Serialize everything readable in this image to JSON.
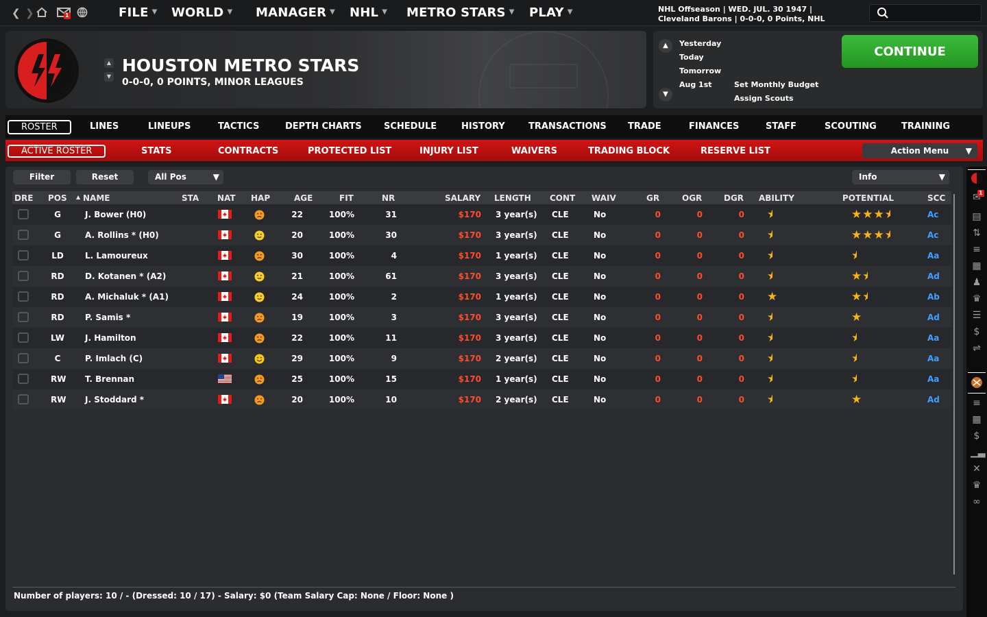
{
  "topbar": {
    "menus": [
      "FILE",
      "WORLD",
      "MANAGER",
      "NHL",
      "METRO STARS",
      "PLAY"
    ],
    "mail_badge": "1",
    "status_line1": "NHL Offseason |  WED. JUL. 30 1947 |",
    "status_line2": "Cleveland Barons |  0-0-0, 0 Points, NHL"
  },
  "team": {
    "name": "HOUSTON METRO STARS",
    "record": "0-0-0, 0 POINTS, MINOR LEAGUES"
  },
  "schedule": {
    "items": [
      "Yesterday",
      "Today",
      "Tomorrow",
      "Aug 1st"
    ],
    "tasks": [
      "Set Monthly Budget",
      "Assign Scouts"
    ],
    "continue_label": "CONTINUE"
  },
  "tabs_primary": [
    "ROSTER",
    "LINES",
    "LINEUPS",
    "TACTICS",
    "DEPTH CHARTS",
    "SCHEDULE",
    "HISTORY",
    "TRANSACTIONS",
    "TRADE",
    "FINANCES",
    "STAFF",
    "SCOUTING",
    "TRAINING"
  ],
  "tabs_secondary": [
    "ACTIVE ROSTER",
    "STATS",
    "CONTRACTS",
    "PROTECTED LIST",
    "INJURY LIST",
    "WAIVERS",
    "TRADING BLOCK",
    "RESERVE LIST"
  ],
  "action_menu": "Action Menu",
  "toolbar": {
    "filter": "Filter",
    "reset": "Reset",
    "position_select": "All Pos",
    "info_select": "Info"
  },
  "table": {
    "headers": [
      "DRE",
      "POS",
      "NAME",
      "STA",
      "NAT",
      "HAP",
      "AGE",
      "FIT",
      "NR",
      "SALARY",
      "LENGTH",
      "CONT",
      "WAIV",
      "GR",
      "OGR",
      "DGR",
      "ABILITY",
      "POTENTIAL",
      "SCC"
    ],
    "rows": [
      {
        "pos": "G",
        "name": "J. Bower (H0)",
        "nat": "CAN",
        "hap": "unhappy",
        "age": "22",
        "fit": "100%",
        "nr": "31",
        "salary": "$170",
        "length": "3 year(s)",
        "cont": "CLE",
        "waiv": "No",
        "gr": "0",
        "ogr": "0",
        "dgr": "0",
        "ability": 0.5,
        "potential": 3.5,
        "scc": "Ac"
      },
      {
        "pos": "G",
        "name": "A. Rollins *  (H0)",
        "nat": "CAN",
        "hap": "content",
        "age": "20",
        "fit": "100%",
        "nr": "30",
        "salary": "$170",
        "length": "3 year(s)",
        "cont": "CLE",
        "waiv": "No",
        "gr": "0",
        "ogr": "0",
        "dgr": "0",
        "ability": 0.5,
        "potential": 3.5,
        "scc": "Ac"
      },
      {
        "pos": "LD",
        "name": "L. Lamoureux",
        "nat": "CAN",
        "hap": "unhappy",
        "age": "30",
        "fit": "100%",
        "nr": "4",
        "salary": "$170",
        "length": "1 year(s)",
        "cont": "CLE",
        "waiv": "No",
        "gr": "0",
        "ogr": "0",
        "dgr": "0",
        "ability": 0.5,
        "potential": 0.5,
        "scc": "Aa"
      },
      {
        "pos": "RD",
        "name": "D. Kotanen *  (A2)",
        "nat": "CAN",
        "hap": "content",
        "age": "21",
        "fit": "100%",
        "nr": "61",
        "salary": "$170",
        "length": "3 year(s)",
        "cont": "CLE",
        "waiv": "No",
        "gr": "0",
        "ogr": "0",
        "dgr": "0",
        "ability": 0.5,
        "potential": 1.5,
        "scc": "Ad"
      },
      {
        "pos": "RD",
        "name": "A. Michaluk *  (A1)",
        "nat": "CAN",
        "hap": "content",
        "age": "24",
        "fit": "100%",
        "nr": "2",
        "salary": "$170",
        "length": "1 year(s)",
        "cont": "CLE",
        "waiv": "No",
        "gr": "0",
        "ogr": "0",
        "dgr": "0",
        "ability": 1,
        "potential": 1.5,
        "scc": "Ab"
      },
      {
        "pos": "RD",
        "name": "P. Samis *",
        "nat": "CAN",
        "hap": "unhappy",
        "age": "19",
        "fit": "100%",
        "nr": "3",
        "salary": "$170",
        "length": "3 year(s)",
        "cont": "CLE",
        "waiv": "No",
        "gr": "0",
        "ogr": "0",
        "dgr": "0",
        "ability": 0.5,
        "potential": 1,
        "scc": "Ad"
      },
      {
        "pos": "LW",
        "name": "J. Hamilton",
        "nat": "CAN",
        "hap": "unhappy",
        "age": "22",
        "fit": "100%",
        "nr": "11",
        "salary": "$170",
        "length": "3 year(s)",
        "cont": "CLE",
        "waiv": "No",
        "gr": "0",
        "ogr": "0",
        "dgr": "0",
        "ability": 0.5,
        "potential": 0.5,
        "scc": "Aa"
      },
      {
        "pos": "C",
        "name": "P. Imlach (C)",
        "nat": "CAN",
        "hap": "happy",
        "age": "29",
        "fit": "100%",
        "nr": "9",
        "salary": "$170",
        "length": "2 year(s)",
        "cont": "CLE",
        "waiv": "No",
        "gr": "0",
        "ogr": "0",
        "dgr": "0",
        "ability": 0.5,
        "potential": 0.5,
        "scc": "Aa"
      },
      {
        "pos": "RW",
        "name": "T. Brennan",
        "nat": "USA",
        "hap": "unhappy",
        "age": "25",
        "fit": "100%",
        "nr": "15",
        "salary": "$170",
        "length": "1 year(s)",
        "cont": "CLE",
        "waiv": "No",
        "gr": "0",
        "ogr": "0",
        "dgr": "0",
        "ability": 0.5,
        "potential": 0.5,
        "scc": "Aa"
      },
      {
        "pos": "RW",
        "name": "J. Stoddard *",
        "nat": "CAN",
        "hap": "unhappy",
        "age": "20",
        "fit": "100%",
        "nr": "10",
        "salary": "$170",
        "length": "2 year(s)",
        "cont": "CLE",
        "waiv": "No",
        "gr": "0",
        "ogr": "0",
        "dgr": "0",
        "ability": 0.5,
        "potential": 1,
        "scc": "Ad"
      }
    ]
  },
  "footer": "Number of players: 10 / - (Dressed: 10 / 17)  -   Salary: $0  (Team Salary Cap: None / Floor: None )",
  "colors": {
    "accent_red": "#cf1414",
    "continue_green": "#2aa52a",
    "salary_red": "#ff4c2a",
    "scc_blue": "#3fa0ff",
    "star_gold": "#f5b315"
  }
}
